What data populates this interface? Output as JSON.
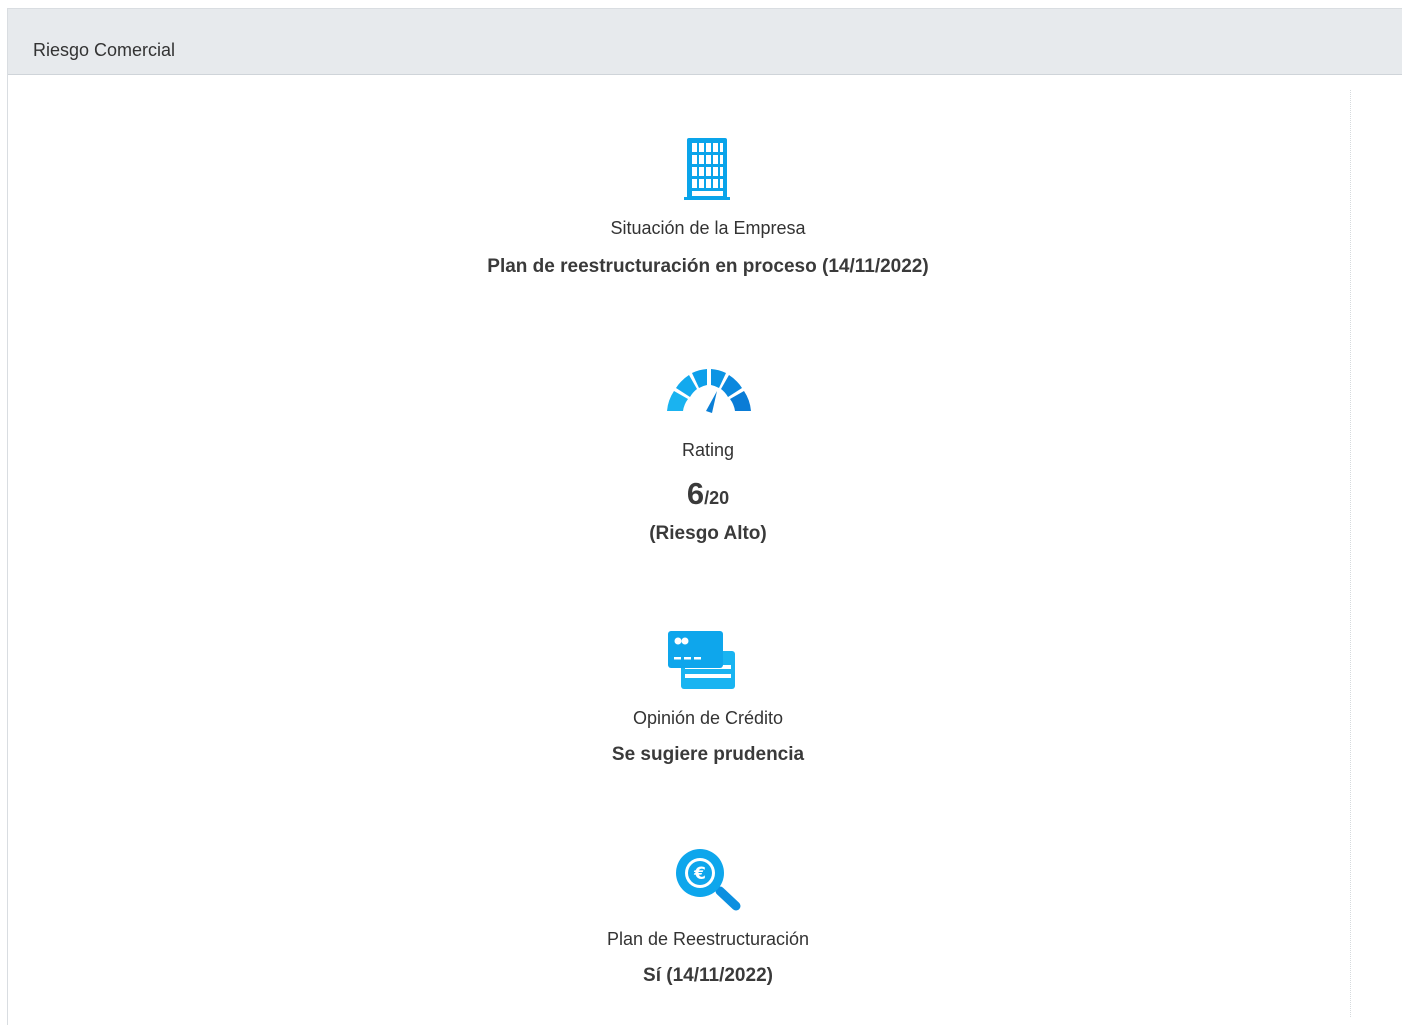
{
  "panel": {
    "title": "Riesgo Comercial"
  },
  "items": [
    {
      "icon": "building-icon",
      "label": "Situación de la Empresa",
      "value": "Plan de reestructuración en proceso (14/11/2022)"
    },
    {
      "icon": "gauge-icon",
      "label": "Rating",
      "score": "6",
      "score_separator": "/",
      "score_max": "20",
      "value": "(Riesgo Alto)"
    },
    {
      "icon": "credit-cards-icon",
      "label": "Opinión de Crédito",
      "value": "Se sugiere prudencia"
    },
    {
      "icon": "euro-search-icon",
      "label": "Plan de Reestructuración",
      "value": "Sí (14/11/2022)"
    }
  ],
  "colors": {
    "accent": "#00a3e8",
    "accent_dark": "#0b7fd6",
    "header_bg": "#e7eaed"
  }
}
